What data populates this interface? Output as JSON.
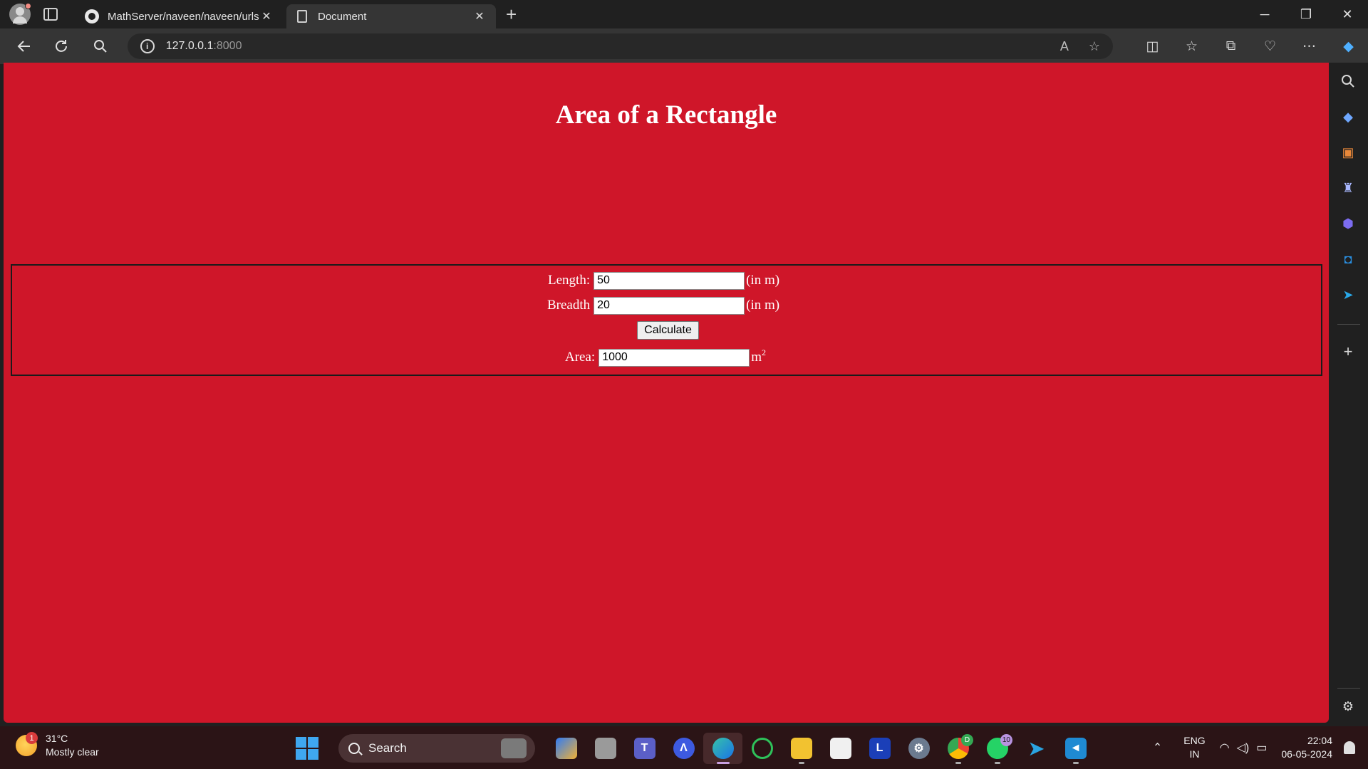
{
  "browser": {
    "tabs": [
      {
        "title": "MathServer/naveen/naveen/urls.",
        "icon": "github-icon",
        "active": false
      },
      {
        "title": "Document",
        "icon": "document-icon",
        "active": true
      }
    ],
    "new_tab": "+",
    "address": {
      "host": "127.0.0.1",
      "port": ":8000"
    },
    "window_controls": {
      "minimize": "─",
      "restore": "❐",
      "close": "✕"
    }
  },
  "page": {
    "title": "Area of a Rectangle",
    "background": "#cf1629",
    "form": {
      "length_label": "Length:",
      "length_value": "50",
      "length_unit": "(in m)",
      "breadth_label": "Breadth",
      "breadth_value": "20",
      "breadth_unit": "(in m)",
      "calculate_label": "Calculate",
      "area_label": "Area:",
      "area_value": "1000",
      "area_unit": "m",
      "area_unit_sup": "2"
    }
  },
  "sidebar": {
    "icons": [
      "search-icon",
      "tag-icon",
      "toolbox-icon",
      "chess-icon",
      "copilot-icon",
      "outlook-icon",
      "send-icon",
      "add-icon",
      "settings-icon"
    ]
  },
  "taskbar": {
    "weather": {
      "badge": "1",
      "temp": "31°C",
      "condition": "Mostly clear"
    },
    "search_label": "Search",
    "apps": [
      {
        "name": "copilot-pre",
        "label": "",
        "badge": ""
      },
      {
        "name": "task-view",
        "label": "",
        "badge": ""
      },
      {
        "name": "teams",
        "label": "",
        "badge": ""
      },
      {
        "name": "arc",
        "label": "",
        "badge": ""
      },
      {
        "name": "edge",
        "label": "",
        "badge": "",
        "active": true
      },
      {
        "name": "circle-app",
        "label": "",
        "badge": ""
      },
      {
        "name": "file-explorer",
        "label": "",
        "badge": ""
      },
      {
        "name": "store",
        "label": "",
        "badge": ""
      },
      {
        "name": "l-app",
        "label": "L",
        "badge": ""
      },
      {
        "name": "settings-app",
        "label": "",
        "badge": ""
      },
      {
        "name": "chrome",
        "label": "",
        "badge": "D"
      },
      {
        "name": "whatsapp",
        "label": "",
        "badge": "10"
      },
      {
        "name": "telegram",
        "label": "",
        "badge": ""
      },
      {
        "name": "vscode",
        "label": "",
        "badge": ""
      }
    ],
    "language": {
      "line1": "ENG",
      "line2": "IN"
    },
    "clock": {
      "time": "22:04",
      "date": "06-05-2024"
    }
  }
}
